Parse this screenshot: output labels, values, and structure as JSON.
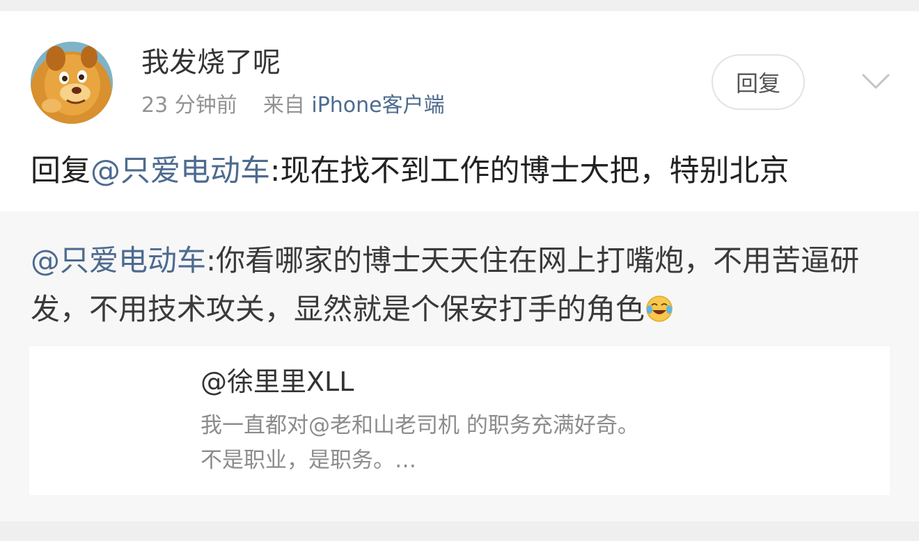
{
  "post": {
    "username": "我发烧了呢",
    "time": "23 分钟前",
    "from_label": "来自",
    "source": "iPhone客户端",
    "reply_button": "回复",
    "reply_prefix": "回复",
    "reply_mention": "@只爱电动车",
    "reply_body": ":现在找不到工作的博士大把，特别北京"
  },
  "quoted": {
    "mention": "@只爱电动车",
    "body": ":你看哪家的博士天天住在网上打嘴炮，不用苦逼研发，不用技术攻关，显然就是个保安打手的角色",
    "emoji": "laughing-crying-emoji"
  },
  "original": {
    "user": "@徐里里XLL",
    "line1": "我一直都对@老和山老司机 的职务充满好奇。",
    "line2": "不是职业，是职务。…"
  },
  "icons": {
    "avatar": "lion-cub-avatar",
    "menu": "chevron-down-icon"
  },
  "colors": {
    "link": "#4d6b8f",
    "meta": "#939393",
    "text": "#222222"
  }
}
